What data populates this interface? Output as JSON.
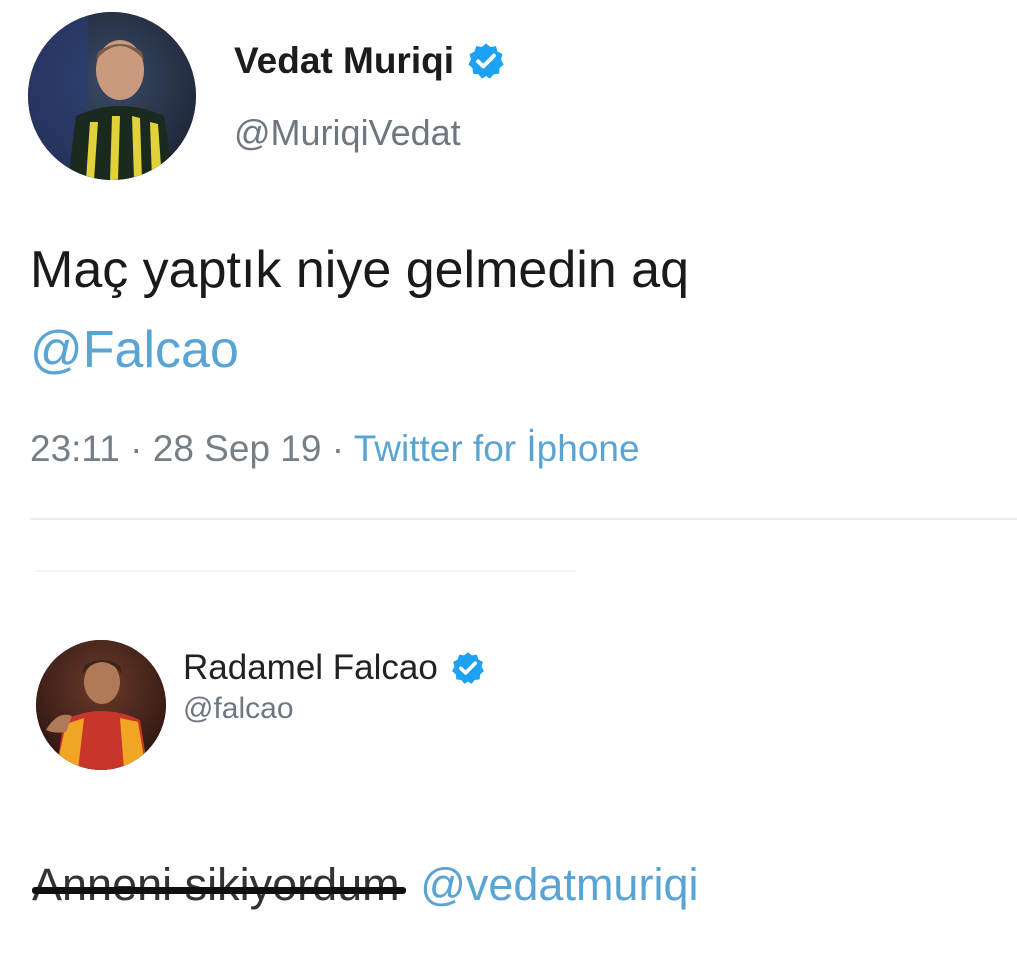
{
  "tweets": [
    {
      "display_name": "Vedat Muriqi",
      "handle": "@MuriqiVedat",
      "verified": true,
      "text_main": "Maç yaptık niye gelmedin aq",
      "text_mention": "@Falcao",
      "time": "23:11",
      "date": "28 Sep 19",
      "separator": "·",
      "source": "Twitter for İphone"
    },
    {
      "display_name": "Radamel Falcao",
      "handle": "@falcao",
      "verified": true,
      "text_censored": "Anneni sikiyordum",
      "text_mention": "@vedatmuriqi"
    }
  ],
  "colors": {
    "link": "#5aa4d4",
    "verified_badge": "#1da1f2",
    "meta_gray": "#767e86"
  },
  "icons": {
    "verified": "verified-badge-icon"
  }
}
